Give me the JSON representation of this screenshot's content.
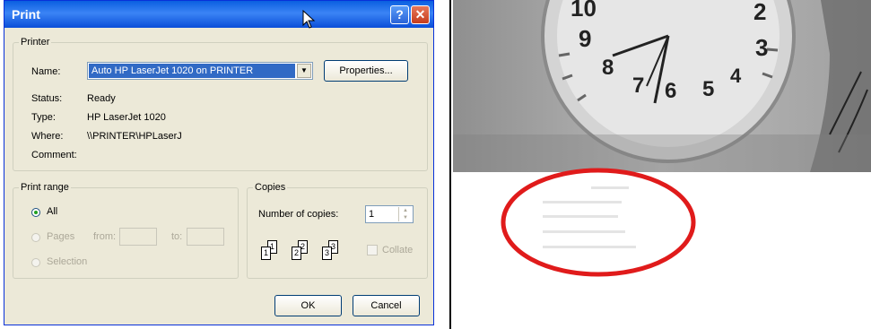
{
  "dialog": {
    "title": "Print",
    "help_label": "?",
    "close_label": "✕",
    "printer": {
      "group_label": "Printer",
      "name_label": "Name:",
      "name_value": "Auto HP LaserJet 1020 on PRINTER",
      "properties_label": "Properties...",
      "status_label": "Status:",
      "status_value": "Ready",
      "type_label": "Type:",
      "type_value": "HP LaserJet 1020",
      "where_label": "Where:",
      "where_value": "\\\\PRINTER\\HPLaserJ",
      "comment_label": "Comment:"
    },
    "print_range": {
      "group_label": "Print range",
      "all_label": "All",
      "pages_label": "Pages",
      "from_label": "from:",
      "to_label": "to:",
      "selection_label": "Selection",
      "selected": "All"
    },
    "copies": {
      "group_label": "Copies",
      "number_label": "Number of copies:",
      "number_value": "1",
      "collate_label": "Collate",
      "collate_checked": false
    },
    "ok_label": "OK",
    "cancel_label": "Cancel"
  },
  "photo": {
    "clock_numbers": [
      "10",
      "2",
      "9",
      "3",
      "8",
      "4",
      "7",
      "6",
      "5"
    ],
    "circle_color": "#e01b1b"
  }
}
